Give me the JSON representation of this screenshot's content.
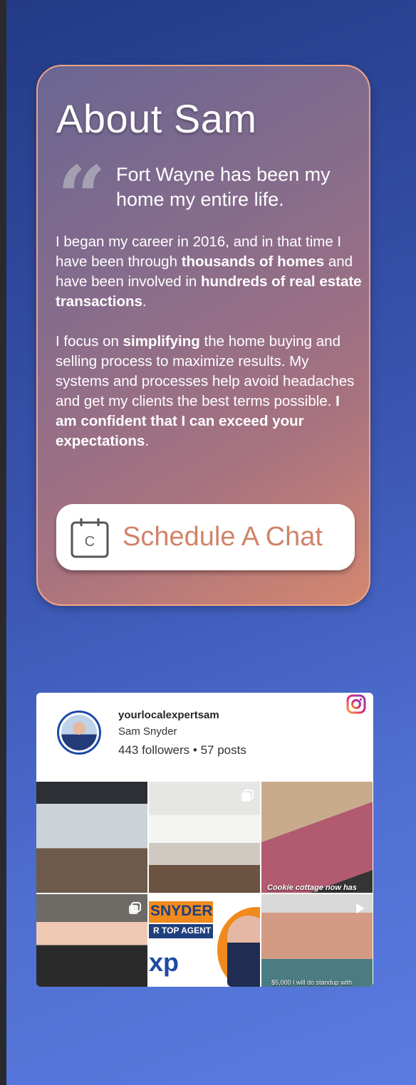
{
  "about": {
    "title": "About Sam",
    "quote": "Fort Wayne has been my home my entire life.",
    "p1_a": "I began my career in 2016, and in that time I have been through ",
    "p1_b": "thousands of homes",
    "p1_c": " and have been involved in ",
    "p1_d": "hundreds of real estate transactions",
    "p1_e": ".",
    "p2_a": "I focus on ",
    "p2_b": "simplifying",
    "p2_c": " the home buying and selling process to maximize results. My systems and processes help avoid headaches and get my clients the best terms possible.   ",
    "p2_d": "I am confident that I can exceed your expectations",
    "p2_e": ".",
    "button_label": "Schedule A Chat",
    "button_icon": "calendar-icon",
    "calendar_letter": "C"
  },
  "instagram": {
    "username": "yourlocalexpertsam",
    "full_name": "Sam Snyder",
    "stats": "443 followers • 57 posts",
    "logo_icon": "instagram-icon",
    "posts": [
      {
        "caption": ""
      },
      {
        "caption": ""
      },
      {
        "caption": "Cookie cottage now has"
      },
      {
        "caption": ""
      },
      {
        "caption": "",
        "banner_name": "SNYDER",
        "banner_tag": "R TOP AGENT",
        "brand": "xp"
      },
      {
        "caption": "$5,000 I will do standup with"
      }
    ]
  },
  "colors": {
    "background": "#3a55b0",
    "card_border": "#f2a487",
    "button_text": "#d08469",
    "instagram_avatar_ring": "#1d49a7"
  }
}
